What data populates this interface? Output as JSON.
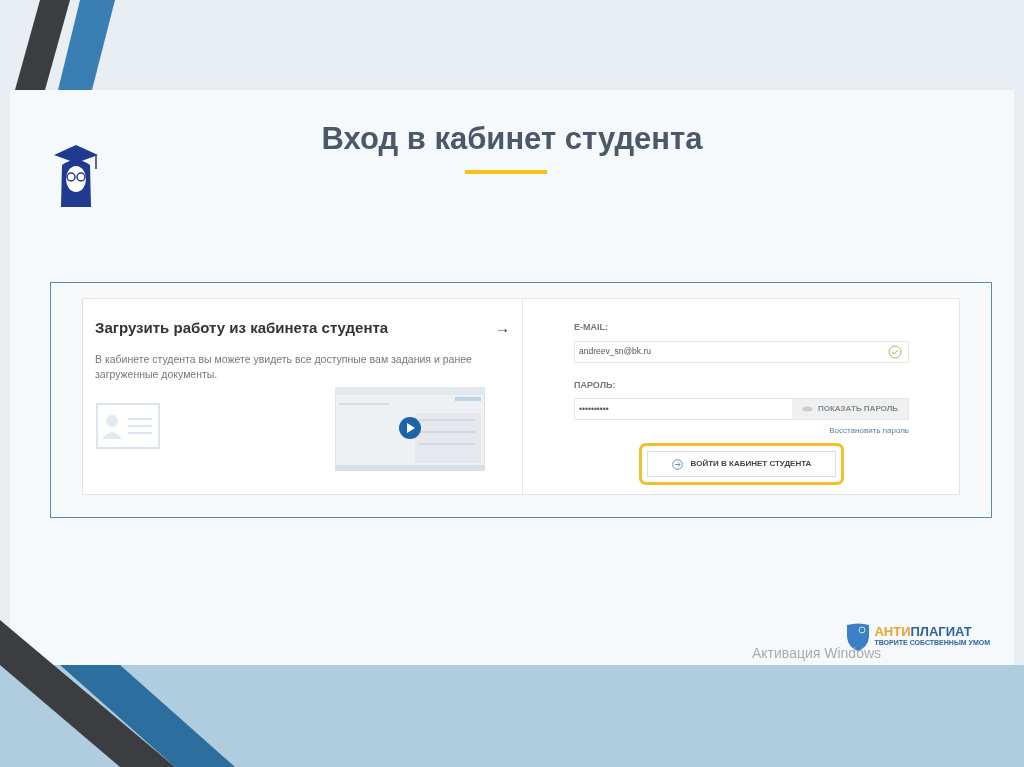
{
  "slide": {
    "title": "Вход в кабинет студента"
  },
  "upload": {
    "title": "Загрузить работу из кабинета студента",
    "arrow": "→",
    "description": "В кабинете студента вы можете увидеть все доступные вам задания и ранее загруженные документы."
  },
  "login": {
    "email": {
      "label": "E-MAIL:",
      "value": "andreev_sn@bk.ru",
      "valid": true
    },
    "password": {
      "label": "ПАРОЛЬ:",
      "value": "••••••••••",
      "show_button": "ПОКАЗАТЬ ПАРОЛЬ"
    },
    "restore_link": "Восстановить пароль",
    "submit": {
      "label": "ВОЙТИ В КАБИНЕТ СТУДЕНТА",
      "highlighted": true
    }
  },
  "brand": {
    "name_accent": "АНТИ",
    "name_rest": "ПЛАГИАТ",
    "slogan": "ТВОРИТЕ СОБСТВЕННЫМ УМОМ"
  },
  "overlay_text": "Активация Windows"
}
